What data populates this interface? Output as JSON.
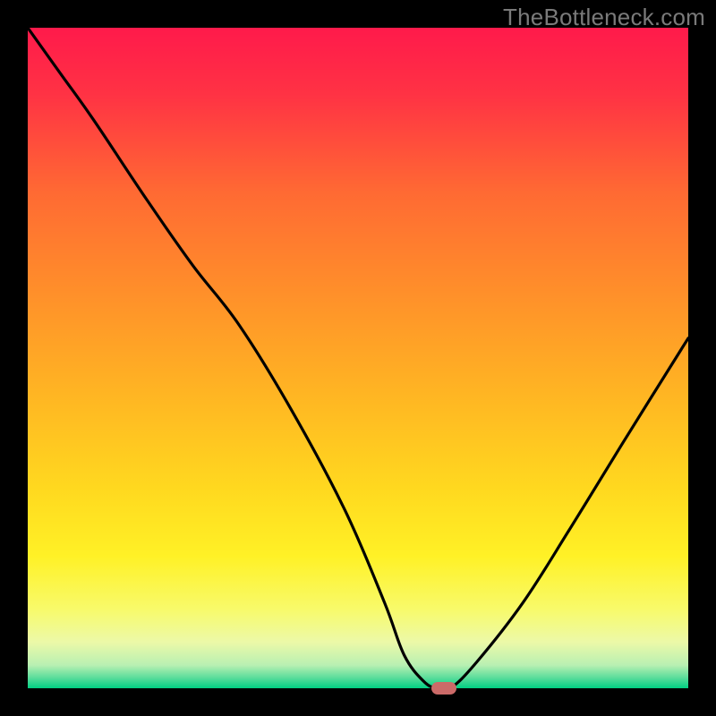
{
  "watermark": "TheBottleneck.com",
  "chart_data": {
    "type": "line",
    "title": "",
    "xlabel": "",
    "ylabel": "",
    "xlim": [
      0,
      100
    ],
    "ylim": [
      0,
      100
    ],
    "grid": false,
    "legend": false,
    "series": [
      {
        "name": "bottleneck-curve",
        "x": [
          0,
          5,
          10,
          18,
          25,
          32,
          40,
          48,
          54,
          57,
          60,
          62,
          64,
          68,
          75,
          82,
          90,
          100
        ],
        "y": [
          100,
          93,
          86,
          74,
          64,
          55,
          42,
          27,
          13,
          5,
          1,
          0,
          0,
          4,
          13,
          24,
          37,
          53
        ]
      }
    ],
    "marker": {
      "x": 63,
      "y": 0,
      "color": "#cb6a68"
    },
    "background_gradient": {
      "stops": [
        {
          "offset": 0.0,
          "color": "#ff1a4b"
        },
        {
          "offset": 0.1,
          "color": "#ff3244"
        },
        {
          "offset": 0.25,
          "color": "#ff6a33"
        },
        {
          "offset": 0.4,
          "color": "#ff8f2a"
        },
        {
          "offset": 0.55,
          "color": "#ffb423"
        },
        {
          "offset": 0.7,
          "color": "#ffd91f"
        },
        {
          "offset": 0.8,
          "color": "#fff126"
        },
        {
          "offset": 0.88,
          "color": "#f8fa6a"
        },
        {
          "offset": 0.93,
          "color": "#ecf9a8"
        },
        {
          "offset": 0.965,
          "color": "#b9f0b2"
        },
        {
          "offset": 0.985,
          "color": "#55dc9a"
        },
        {
          "offset": 1.0,
          "color": "#00cf82"
        }
      ]
    }
  }
}
